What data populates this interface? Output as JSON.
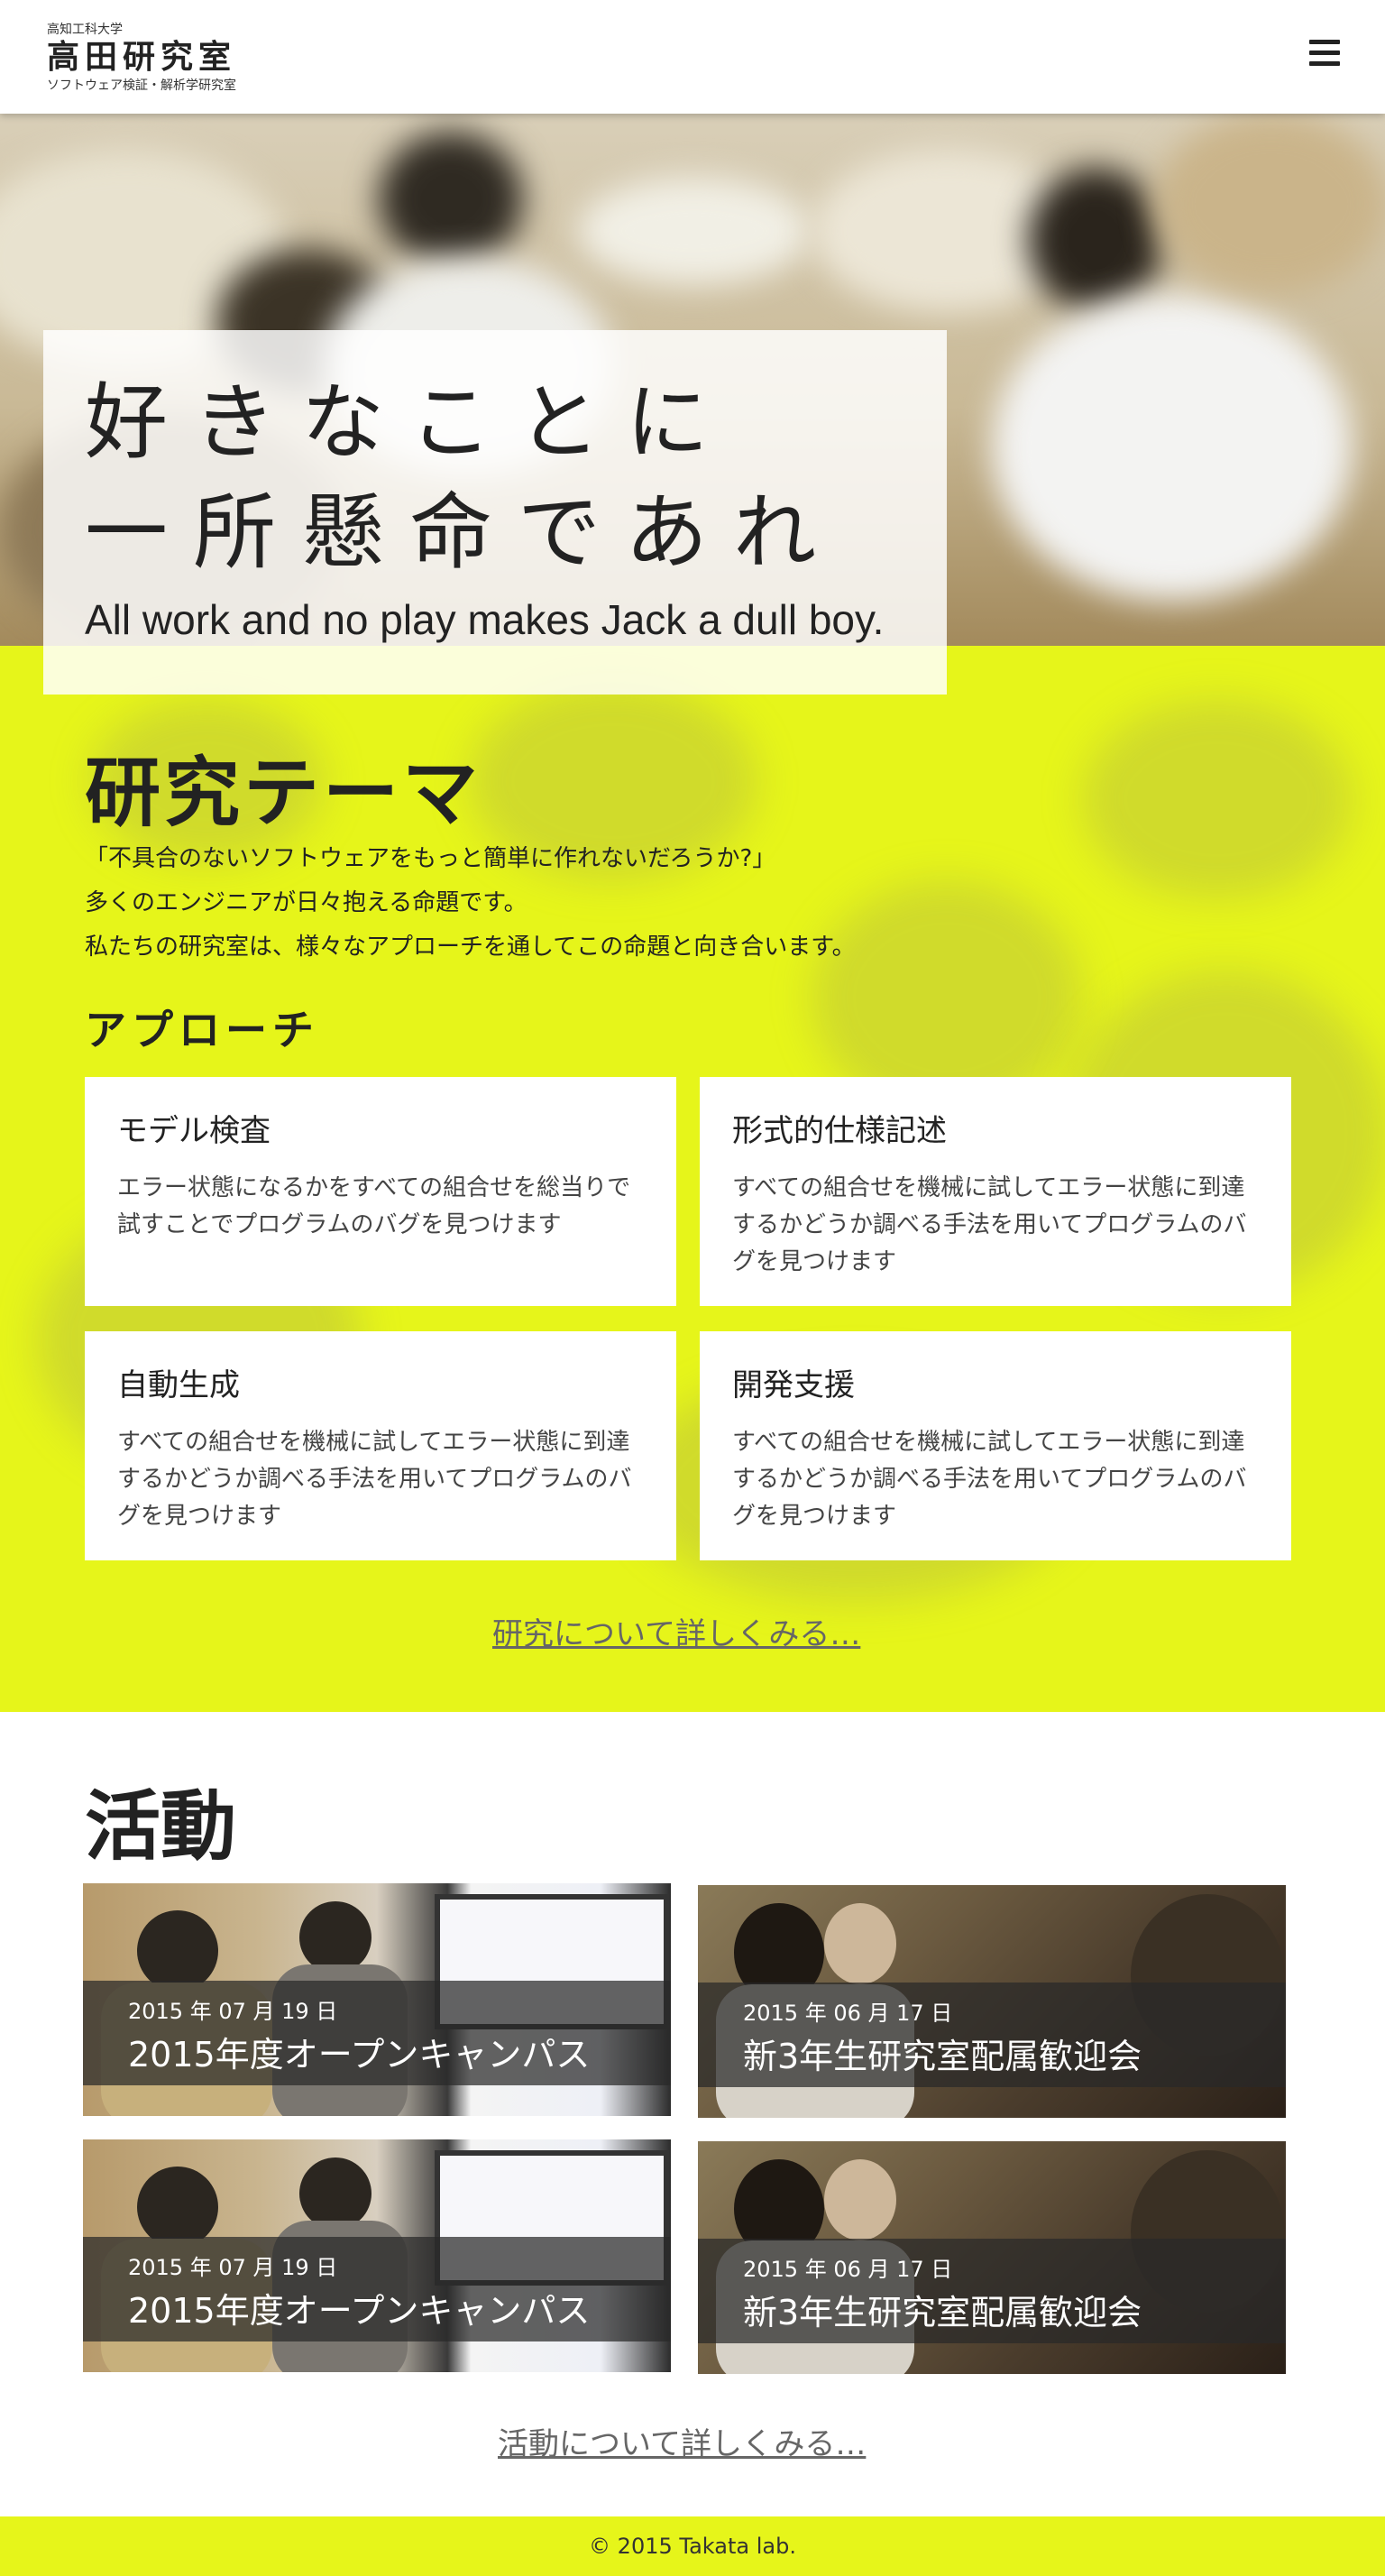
{
  "header": {
    "univ": "高知工科大学",
    "lab_name": "高田研究室",
    "subtitle": "ソフトウェア検証・解析学研究室",
    "menu_icon": "hamburger-menu-icon"
  },
  "hero": {
    "line1": "好きなことに",
    "line2": "一所懸命であれ",
    "english": "All work and no play makes Jack a dull boy."
  },
  "research": {
    "title": "研究テーマ",
    "paragraphs": [
      "「不具合のないソフトウェアをもっと簡単に作れないだろうか?」",
      "多くのエンジニアが日々抱える命題です。",
      "私たちの研究室は、様々なアプローチを通してこの命題と向き合います。"
    ],
    "approach_title": "アプローチ",
    "cards": [
      {
        "title": "モデル検査",
        "text": "エラー状態になるかをすべての組合せを総当りで試すことでプログラムのバグを見つけます"
      },
      {
        "title": "形式的仕様記述",
        "text": "すべての組合せを機械に試してエラー状態に到達するかどうか調べる手法を用いてプログラムのバグを見つけます"
      },
      {
        "title": "自動生成",
        "text": "すべての組合せを機械に試してエラー状態に到達するかどうか調べる手法を用いてプログラムのバグを見つけます"
      },
      {
        "title": "開発支援",
        "text": "すべての組合せを機械に試してエラー状態に到達するかどうか調べる手法を用いてプログラムのバグを見つけます"
      }
    ],
    "more_link": "研究について詳しくみる…"
  },
  "activities": {
    "title": "活動",
    "items": [
      {
        "date": "2015 年 07 月 19 日",
        "name": "2015年度オープンキャンパス"
      },
      {
        "date": "2015 年 06 月 17 日",
        "name": "新3年生研究室配属歓迎会"
      },
      {
        "date": "2015 年 07 月 19 日",
        "name": "2015年度オープンキャンパス"
      },
      {
        "date": "2015 年 06 月 17 日",
        "name": "新3年生研究室配属歓迎会"
      }
    ],
    "more_link": "活動について詳しくみる…"
  },
  "footer": {
    "copyright": "© 2015 Takata lab."
  },
  "colors": {
    "accent_yellow": "#e6f51a",
    "caption_overlay": "#282828"
  }
}
